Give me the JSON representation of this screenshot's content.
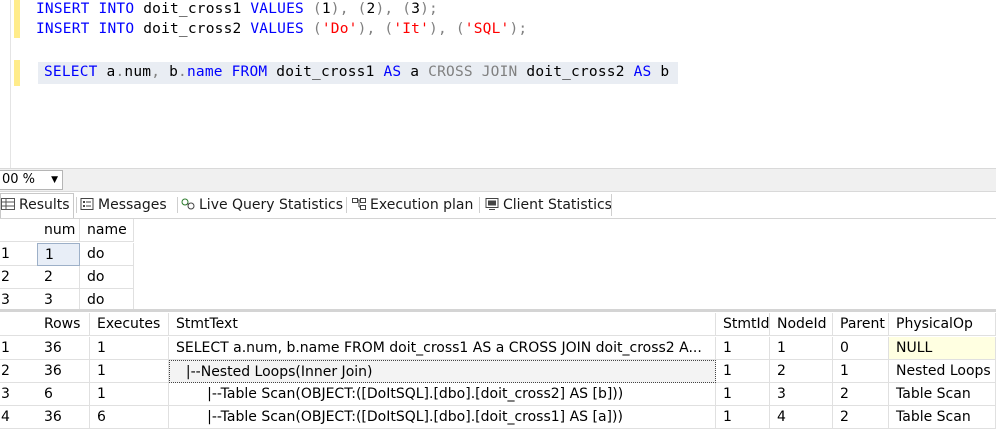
{
  "editor": {
    "line1": {
      "kw1": "INSERT",
      "kw2": "INTO",
      "table": "doit_cross1",
      "kw3": "VALUES",
      "v1": "1",
      "v2": "2",
      "v3": "3"
    },
    "line2": {
      "kw1": "INSERT",
      "kw2": "INTO",
      "table": "doit_cross2",
      "kw3": "VALUES",
      "v1": "'Do'",
      "v2": "'It'",
      "v3": "'SQL'"
    },
    "line3": {
      "select": "SELECT",
      "f1a": "a",
      "f1b": "num",
      "f2a": "b",
      "f2b": "name",
      "from": "FROM",
      "t1": "doit_cross1",
      "as1": "AS",
      "al1": "a",
      "cj": "CROSS JOIN",
      "t2": "doit_cross2",
      "as2": "AS",
      "al2": "b"
    }
  },
  "zoom": {
    "value": "00 %"
  },
  "tabs": [
    "Results",
    "Messages",
    "Live Query Statistics",
    "Execution plan",
    "Client Statistics"
  ],
  "grid1": {
    "columns": [
      "num",
      "name"
    ],
    "rows": [
      [
        "1",
        "1",
        "do"
      ],
      [
        "2",
        "2",
        "do"
      ],
      [
        "3",
        "3",
        "do"
      ]
    ]
  },
  "grid2": {
    "columns": [
      "Rows",
      "Executes",
      "StmtText",
      "StmtId",
      "NodeId",
      "Parent",
      "PhysicalOp"
    ],
    "rows": [
      [
        "1",
        "36",
        "1",
        "SELECT a.num, b.name FROM doit_cross1 AS a CROSS JOIN doit_cross2 A...",
        "1",
        "1",
        "0",
        "NULL"
      ],
      [
        "2",
        "36",
        "1",
        "  |--Nested Loops(Inner Join)",
        "1",
        "2",
        "1",
        "Nested Loops"
      ],
      [
        "3",
        "6",
        "1",
        "       |--Table Scan(OBJECT:([DoItSQL].[dbo].[doit_cross2] AS [b]))",
        "1",
        "3",
        "2",
        "Table Scan"
      ],
      [
        "4",
        "36",
        "6",
        "       |--Table Scan(OBJECT:([DoItSQL].[dbo].[doit_cross1] AS [a]))",
        "1",
        "4",
        "2",
        "Table Scan"
      ]
    ]
  }
}
